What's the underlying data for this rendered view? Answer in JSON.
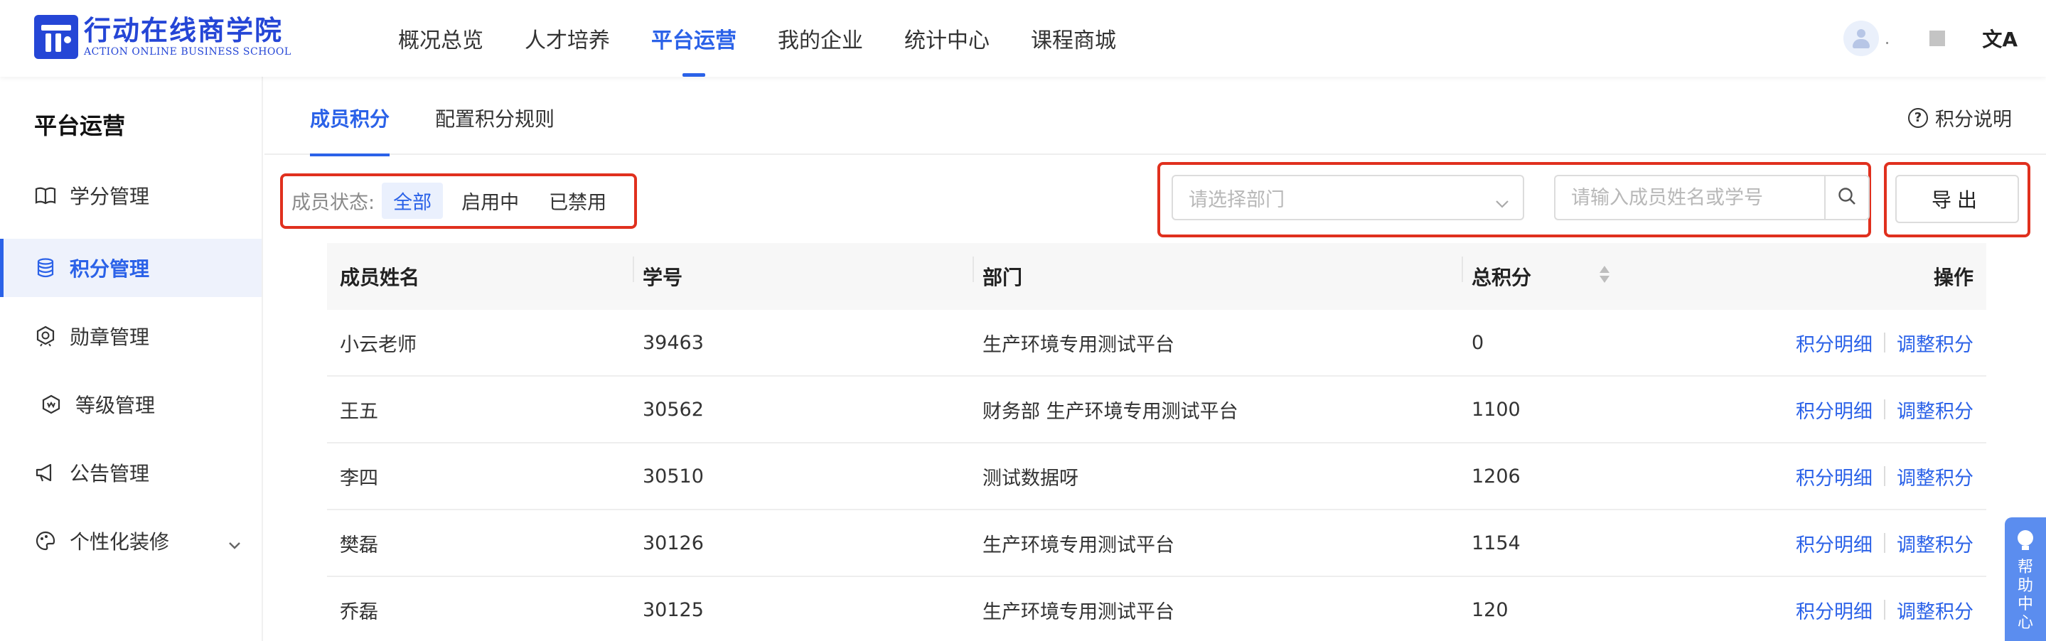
{
  "header": {
    "logo_cn": "行动在线商学院",
    "logo_en": "ACTION ONLINE BUSINESS SCHOOL",
    "nav": [
      {
        "label": "概况总览",
        "active": false
      },
      {
        "label": "人才培养",
        "active": false
      },
      {
        "label": "平台运营",
        "active": true
      },
      {
        "label": "我的企业",
        "active": false
      },
      {
        "label": "统计中心",
        "active": false
      },
      {
        "label": "课程商城",
        "active": false
      }
    ],
    "username": ".",
    "lang_icon": "文A"
  },
  "sidebar": {
    "title": "平台运营",
    "items": [
      {
        "label": "学分管理",
        "icon": "book-icon",
        "active": false
      },
      {
        "label": "积分管理",
        "icon": "database-icon",
        "active": true
      },
      {
        "label": "勋章管理",
        "icon": "medal-icon",
        "active": false
      },
      {
        "label": "等级管理",
        "icon": "level-icon",
        "active": false
      },
      {
        "label": "公告管理",
        "icon": "megaphone-icon",
        "active": false
      },
      {
        "label": "个性化装修",
        "icon": "palette-icon",
        "active": false
      }
    ]
  },
  "tabs": [
    {
      "label": "成员积分",
      "active": true
    },
    {
      "label": "配置积分规则",
      "active": false
    }
  ],
  "explain_label": "积分说明",
  "filter": {
    "label": "成员状态:",
    "options": [
      {
        "label": "全部",
        "active": true
      },
      {
        "label": "启用中",
        "active": false
      },
      {
        "label": "已禁用",
        "active": false
      }
    ]
  },
  "search": {
    "dept_placeholder": "请选择部门",
    "name_placeholder": "请输入成员姓名或学号"
  },
  "export_label": "导出",
  "table": {
    "columns": [
      "成员姓名",
      "学号",
      "部门",
      "总积分",
      "操作"
    ],
    "rows": [
      {
        "name": "小云老师",
        "id": "39463",
        "dept": "生产环境专用测试平台",
        "points": "0"
      },
      {
        "name": "王五",
        "id": "30562",
        "dept": "财务部 生产环境专用测试平台",
        "points": "1100"
      },
      {
        "name": "李四",
        "id": "30510",
        "dept": "测试数据呀",
        "points": "1206"
      },
      {
        "name": "樊磊",
        "id": "30126",
        "dept": "生产环境专用测试平台",
        "points": "1154"
      },
      {
        "name": "乔磊",
        "id": "30125",
        "dept": "生产环境专用测试平台",
        "points": "120"
      }
    ],
    "op_detail": "积分明细",
    "op_adjust": "调整积分"
  },
  "help_label": "帮助中心",
  "colors": {
    "accent": "#2b62e8",
    "logo": "#2546d6",
    "highlight_border": "#e0301e",
    "help_bg": "#5b8def"
  }
}
